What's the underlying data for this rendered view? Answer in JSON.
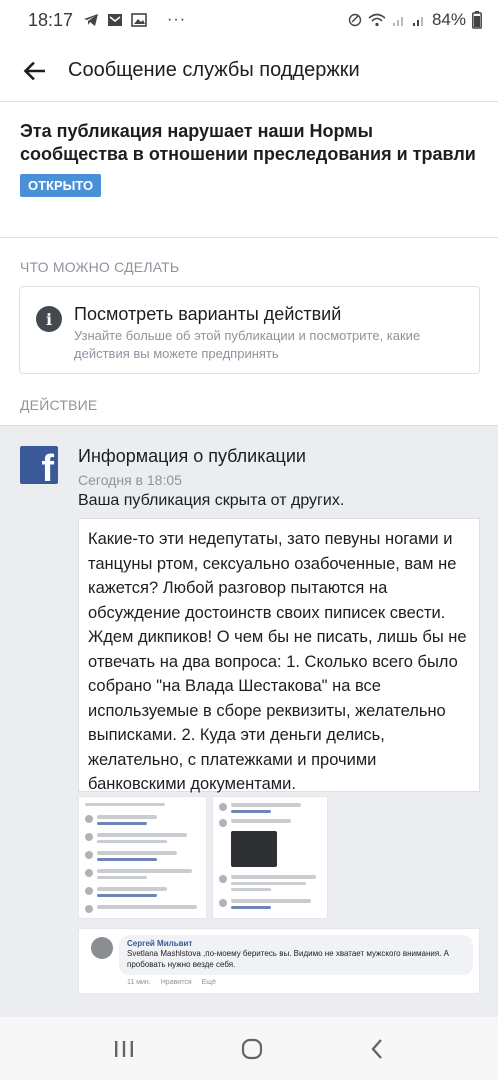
{
  "status_bar": {
    "time": "18:17",
    "battery": "84%"
  },
  "header": {
    "title": "Сообщение службы поддержки"
  },
  "violation": {
    "title": "Эта публикация нарушает наши Нормы сообщества в отношении преследования и травли",
    "status": "ОТКРЫТО"
  },
  "what_to_do": {
    "label": "ЧТО МОЖНО СДЕЛАТЬ",
    "option_title": "Посмотреть варианты действий",
    "option_desc": "Узнайте больше об этой публикации и посмотрите, какие действия вы можете предпринять"
  },
  "action": {
    "label": "ДЕЙСТВИЕ"
  },
  "message": {
    "title": "Информация о публикации",
    "time": "Сегодня в 18:05",
    "subtitle": "Ваша публикация скрыта от других.",
    "quote": "Какие-то эти недепутаты, зато певуны ногами и танцуны ртом, сексуально озабоченные, вам не кажется? Любой разговор пытаются на обсуждение достоинств своих пиписек свести. Ждем дикпиков! О чем бы не писать, лишь бы не отвечать на два вопроса: 1. Сколько всего было собрано \"на Влада Шестакова\" на все используемые в сборе реквизиты, желательно выписками. 2. Куда эти деньги делись, желательно, с платежками и прочими банковскими документами."
  },
  "comment": {
    "author": "Сергей Мильвит",
    "text": "Svetlana Mashlstova ,по-моему беритесь вы. Видимо не хватает мужского внимания. А пробовать нужно везде себя.",
    "time": "11 мин.",
    "like": "Нравится",
    "more": "Ещё"
  },
  "colors": {
    "badge": "#4a90d9",
    "facebook": "#3b5998",
    "message_bg": "#ebedf0"
  }
}
